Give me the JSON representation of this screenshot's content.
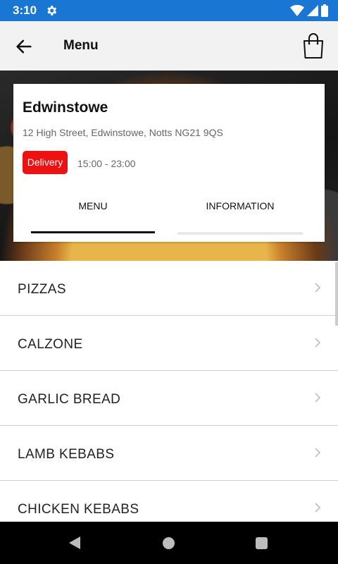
{
  "status_bar": {
    "time": "3:10"
  },
  "app_bar": {
    "title": "Menu"
  },
  "store": {
    "name": "Edwinstowe",
    "address": "12 High Street, Edwinstowe, Notts NG21 9QS",
    "service_badge": "Delivery",
    "hours": "15:00 - 23:00"
  },
  "tabs": [
    {
      "label": "MENU",
      "active": true
    },
    {
      "label": "INFORMATION",
      "active": false
    }
  ],
  "categories": [
    {
      "label": "PIZZAS"
    },
    {
      "label": "CALZONE"
    },
    {
      "label": "GARLIC BREAD"
    },
    {
      "label": "LAMB KEBABS"
    },
    {
      "label": "CHICKEN KEBABS"
    }
  ],
  "colors": {
    "status_bar": "#1976d2",
    "app_bar": "#f2f2f2",
    "badge": "#ee1111",
    "nav_bar": "#000000"
  }
}
